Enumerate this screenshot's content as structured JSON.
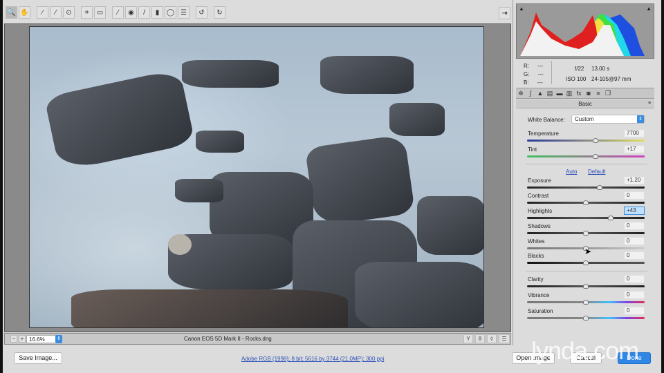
{
  "toolbar": {
    "tools": [
      "zoom-icon",
      "hand-icon",
      "white-balance-icon",
      "color-sampler-icon",
      "targeted-adjustment-icon",
      "crop-icon",
      "straighten-icon",
      "spot-removal-icon",
      "red-eye-icon",
      "adjustment-brush-icon",
      "graduated-filter-icon",
      "radial-filter-icon",
      "preferences-icon",
      "rotate-left-icon",
      "rotate-right-icon"
    ],
    "glyphs": [
      "🔍",
      "✋",
      "⁄",
      "⁄",
      "⊙",
      "⌗",
      "▭",
      "⁄",
      "◉",
      "/",
      "▮",
      "◯",
      "☰",
      "↺",
      "↻"
    ]
  },
  "status": {
    "zoom": "16.6%",
    "filename": "Canon EOS 5D Mark II  -  Rocks.dng"
  },
  "footer": {
    "save": "Save Image...",
    "workflow": "Adobe RGB (1998); 8 bit; 5616 by 3744 (21.0MP); 300 ppi",
    "open": "Open Image",
    "cancel": "Cancel",
    "done": "Done"
  },
  "info": {
    "r_label": "R:",
    "g_label": "G:",
    "b_label": "B:",
    "r": "---",
    "g": "---",
    "b": "---",
    "aperture": "f/22",
    "shutter": "13.00 s",
    "iso": "ISO 100",
    "lens": "24-105@97 mm"
  },
  "panel": {
    "title": "Basic",
    "wb_label": "White Balance:",
    "wb_value": "Custom",
    "auto": "Auto",
    "default": "Default",
    "sliders": [
      {
        "label": "Temperature",
        "value": "7700",
        "fraction": 0.58,
        "track": "temp"
      },
      {
        "label": "Tint",
        "value": "+17",
        "fraction": 0.58,
        "track": "tint"
      },
      {
        "label": "Exposure",
        "value": "+1.20",
        "fraction": 0.62,
        "track": "tone"
      },
      {
        "label": "Contrast",
        "value": "0",
        "fraction": 0.5,
        "track": "tone"
      },
      {
        "label": "Highlights",
        "value": "+43",
        "fraction": 0.71,
        "track": "tone",
        "active": true
      },
      {
        "label": "Shadows",
        "value": "0",
        "fraction": 0.5,
        "track": "tone"
      },
      {
        "label": "Whites",
        "value": "0",
        "fraction": 0.5,
        "track": "light"
      },
      {
        "label": "Blacks",
        "value": "0",
        "fraction": 0.5,
        "track": "dark"
      },
      {
        "label": "Clarity",
        "value": "0",
        "fraction": 0.5,
        "track": "tone"
      },
      {
        "label": "Vibrance",
        "value": "0",
        "fraction": 0.5,
        "track": "color"
      },
      {
        "label": "Saturation",
        "value": "0",
        "fraction": 0.5,
        "track": "color"
      }
    ]
  },
  "watermark": "lynda.com"
}
